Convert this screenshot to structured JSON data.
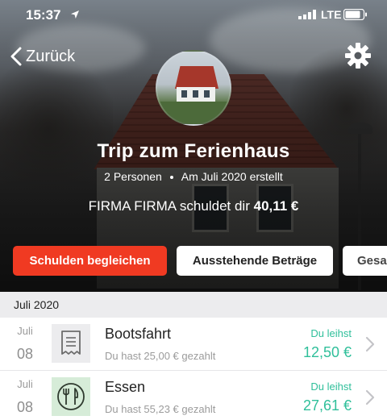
{
  "status_bar": {
    "time": "15:37",
    "network": "LTE",
    "icons": [
      "location-arrow-icon",
      "signal-bars-icon",
      "battery-icon"
    ]
  },
  "nav": {
    "back_label": "Zurück",
    "back_icon": "chevron-left-icon",
    "settings_icon": "gear-icon"
  },
  "trip": {
    "title": "Trip zum Ferienhaus",
    "persons": "2 Personen",
    "created": "Am Juli 2020 erstellt",
    "debt_prefix": "FIRMA FIRMA schuldet dir",
    "debt_amount": "40,11 €"
  },
  "actions": {
    "settle_label": "Schulden begleichen",
    "outstanding_label": "Ausstehende Beträge",
    "total_label": "Gesa"
  },
  "colors": {
    "accent_red": "#f03a22",
    "amount_green": "#2fbf9a"
  },
  "list": {
    "section_header": "Juli 2020",
    "rows": [
      {
        "month": "Juli",
        "day": "08",
        "icon": "receipt-icon",
        "title": "Bootsfahrt",
        "subtitle": "Du hast 25,00 € gezahlt",
        "status_label": "Du leihst",
        "amount": "12,50 €"
      },
      {
        "month": "Juli",
        "day": "08",
        "icon": "fork-knife-icon",
        "title": "Essen",
        "subtitle": "Du hast 55,23 € gezahlt",
        "status_label": "Du leihst",
        "amount": "27,61 €"
      }
    ]
  }
}
